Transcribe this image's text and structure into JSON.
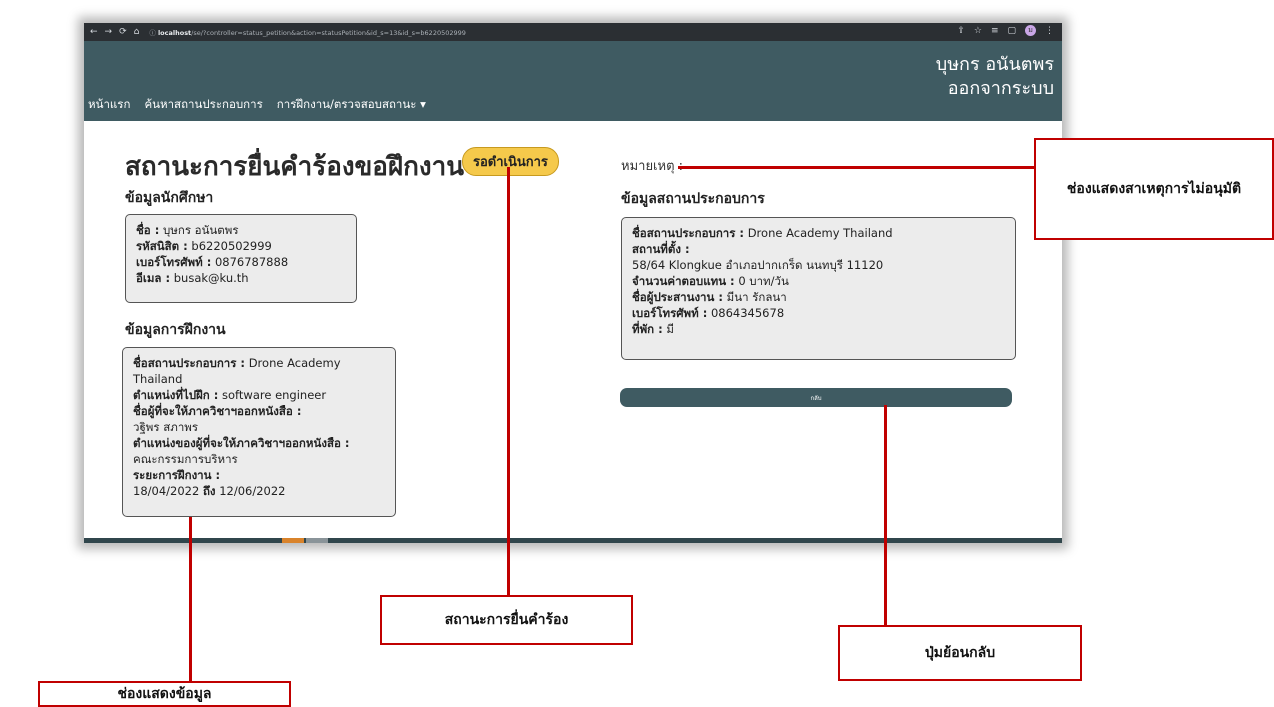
{
  "browser": {
    "url_host": "localhost",
    "url_path": "/se/?controller=status_petition&action=statusPetition&id_s=13&id_s=b6220502999",
    "profile_initial": "ม"
  },
  "navbar": {
    "user_name": "บุษกร อนันตพร",
    "logout_label": "ออกจากระบบ",
    "menu": [
      "หน้าแรก",
      "ค้นหาสถานประกอบการ",
      "การฝึกงาน/ตรวจสอบสถานะ ▾"
    ]
  },
  "page": {
    "title": "สถานะการยื่นคำร้องขอฝึกงาน :",
    "status": "รอดำเนินการ",
    "remark_label": "หมายเหตุ :",
    "back_label": "กลับ"
  },
  "student": {
    "heading": "ข้อมูลนักศึกษา",
    "rows": [
      {
        "k": "ชื่อ :",
        "v": " บุษกร อนันตพร"
      },
      {
        "k": "รหัสนิสิต :",
        "v": " b6220502999"
      },
      {
        "k": "เบอร์โทรศัพท์ :",
        "v": " 0876787888"
      },
      {
        "k": "อีเมล :",
        "v": " busak@ku.th"
      }
    ]
  },
  "training": {
    "heading": "ข้อมูลการฝึกงาน",
    "company_k": "ชื่อสถานประกอบการ :",
    "company_v": " Drone Academy Thailand",
    "position_k": "ตำแหน่งที่ไปฝึก :",
    "position_v": " software engineer",
    "signer_k": "ชื่อผู้ที่จะให้ภาควิชาฯออกหนังสือ :",
    "signer_v": "วฐิพร สภาพร",
    "signer_pos_k": "ตำแหน่งของผู้ที่จะให้ภาควิชาฯออกหนังสือ :",
    "signer_pos_v": "คณะกรรมการบริหาร",
    "period_k": "ระยะการฝึกงาน :",
    "period_from": "18/04/2022",
    "period_to_word": "ถึง",
    "period_to": "12/06/2022"
  },
  "company": {
    "heading": "ข้อมูลสถานประกอบการ",
    "name_k": "ชื่อสถานประกอบการ :",
    "name_v": " Drone Academy Thailand",
    "location_k": "สถานที่ตั้ง :",
    "location_v": "58/64 Klongkue อำเภอปากเกร็ด นนทบุรี 11120",
    "pay_k": "จำนวนค่าตอบแทน :",
    "pay_v": " 0 บาท/วัน",
    "coord_k": "ชื่อผู้ประสานงาน :",
    "coord_v": " มีนา รักลนา",
    "phone_k": "เบอร์โทรศัพท์ :",
    "phone_v": " 0864345678",
    "lodging_k": "ที่พัก :",
    "lodging_v": " มี"
  },
  "callouts": {
    "remark": "ช่องแสดงสาเหตุการไม่อนุมัติ",
    "status": "สถานะการยื่นคำร้อง",
    "back": "ปุ่มย้อนกลับ",
    "info": "ช่องแสดงข้อมูล"
  },
  "colors": {
    "navbar": "#3f5b62",
    "status_pill": "#f5c94b",
    "callout_red": "#c00000"
  }
}
